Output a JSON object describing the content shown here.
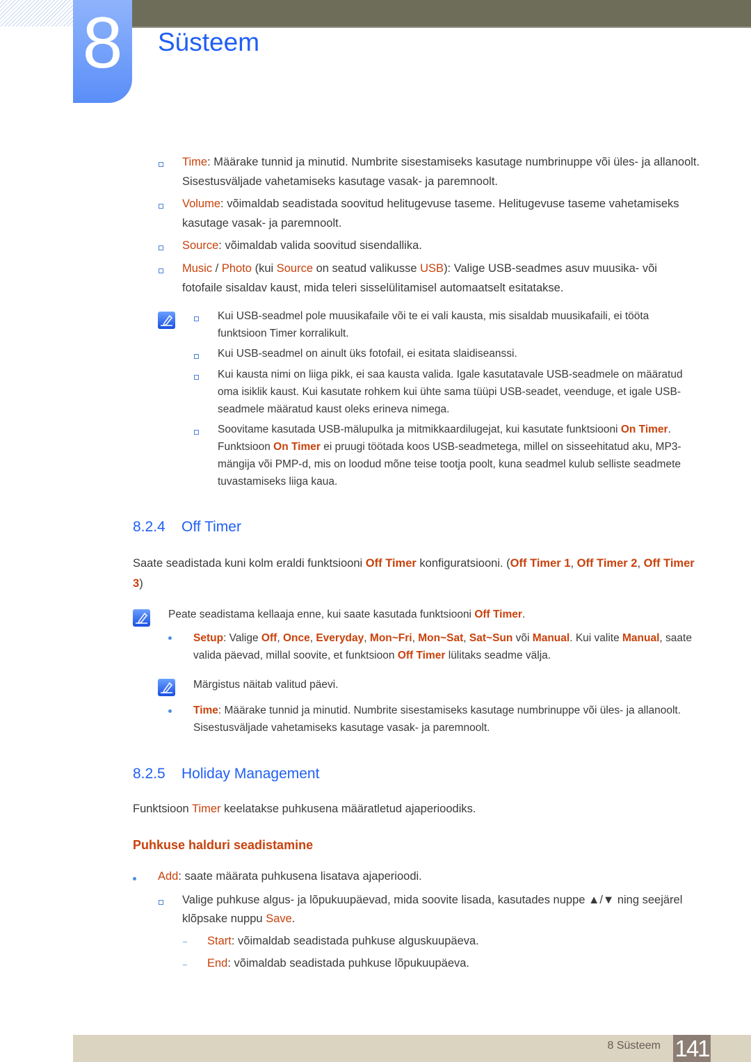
{
  "header": {
    "chapter_number": "8",
    "chapter_title": "Süsteem"
  },
  "colors": {
    "accent_blue": "#1f5ff4",
    "highlight_orange": "#c8420c",
    "header_bar": "#6e6d59",
    "footer_bar": "#dad4c0",
    "page_box": "#8c7e74"
  },
  "intro_list": [
    {
      "key": "Time",
      "text": ": Määrake tunnid ja minutid. Numbrite sisestamiseks kasutage numbrinuppe või üles- ja allanoolt. Sisestusväljade vahetamiseks kasutage vasak- ja paremnoolt."
    },
    {
      "key": "Volume",
      "text": ": võimaldab seadistada soovitud helitugevuse taseme. Helitugevuse taseme vahetamiseks kasutage vasak- ja paremnoolt."
    },
    {
      "key": "Source",
      "text": ": võimaldab valida soovitud sisendallika."
    },
    {
      "key": "Music",
      "sep": " / ",
      "key2": "Photo",
      "t1": " (kui ",
      "key3": "Source",
      "t2": " on seatud valikusse ",
      "key4": "USB",
      "text": "): Valige USB-seadmes asuv muusika- või fotofaile sisaldav kaust, mida teleri sisselülitamisel automaatselt esitatakse."
    }
  ],
  "note1": {
    "icon": "note-pencil-icon",
    "items": [
      {
        "text": "Kui USB-seadmel pole muusikafaile või te ei vali kausta, mis sisaldab muusikafaili, ei tööta funktsioon Timer korralikult."
      },
      {
        "text": "Kui USB-seadmel on ainult üks fotofail, ei esitata slaidiseanssi."
      },
      {
        "text": "Kui kausta nimi on liiga pikk, ei saa kausta valida. Igale kasutatavale USB-seadmele on määratud oma isiklik kaust. Kui kasutate rohkem kui ühte sama tüüpi USB-seadet, veenduge, et igale USB-seadmele määratud kaust oleks erineva nimega."
      },
      {
        "t1": "Soovitame kasutada USB-mälupulka ja mitmikkaardilugejat, kui kasutate funktsiooni ",
        "k1": "On Timer",
        "t2": ". Funktsioon ",
        "k2": "On Timer",
        "t3": " ei pruugi töötada koos USB-seadmetega, millel on sisseehitatud aku, MP3-mängija või PMP-d, mis on loodud mõne teise tootja poolt, kuna seadmel kulub selliste seadmete tuvastamiseks liiga kaua."
      }
    ]
  },
  "section_824": {
    "number": "8.2.4",
    "title": "Off Timer",
    "intro": {
      "t1": "Saate seadistada kuni kolm eraldi funktsiooni ",
      "k1": "Off Timer",
      "t2": " konfiguratsiooni. (",
      "k2": "Off Timer 1",
      "t3": ", ",
      "k3": "Off Timer 2",
      "t4": ", ",
      "k4": "Off Timer 3",
      "t5": ")"
    },
    "note": {
      "t1": "Peate seadistama kellaaja enne, kui saate kasutada funktsiooni ",
      "k1": "Off Timer",
      "t2": "."
    },
    "setup": {
      "key": "Setup",
      "t1": ": Valige ",
      "opts": [
        "Off",
        "Once",
        "Everyday",
        "Mon~Fri",
        "Mon~Sat",
        "Sat~Sun"
      ],
      "t2": " või ",
      "k_manual": "Manual",
      "t3": ". Kui valite ",
      "k_manual2": "Manual",
      "t4": ", saate valida päevad, millal soovite, et funktsioon ",
      "k_off": "Off Timer",
      "t5": " lülitaks seadme välja."
    },
    "note2": "Märgistus näitab valitud päevi.",
    "time": {
      "key": "Time",
      "text": ": Määrake tunnid ja minutid. Numbrite sisestamiseks kasutage numbrinuppe või üles- ja allanoolt. Sisestusväljade vahetamiseks kasutage vasak- ja paremnoolt."
    }
  },
  "section_825": {
    "number": "8.2.5",
    "title": "Holiday Management",
    "intro": {
      "t1": "Funktsioon ",
      "k1": "Timer",
      "t2": " keelatakse puhkusena määratletud ajaperioodiks."
    },
    "subheading": "Puhkuse halduri seadistamine",
    "add": {
      "key": "Add",
      "text": ": saate määrata puhkusena lisatava ajaperioodi."
    },
    "step": {
      "t1": "Valige puhkuse algus- ja lõpukuupäevad, mida soovite lisada, kasutades nuppe ▲/▼ ning seejärel klõpsake nuppu ",
      "k1": "Save",
      "t2": "."
    },
    "subitems": [
      {
        "key": "Start",
        "text": ": võimaldab seadistada puhkuse alguskuupäeva."
      },
      {
        "key": "End",
        "text": ": võimaldab seadistada puhkuse lõpukuupäeva."
      }
    ]
  },
  "footer": {
    "label": "8 Süsteem",
    "page_number": "141"
  }
}
